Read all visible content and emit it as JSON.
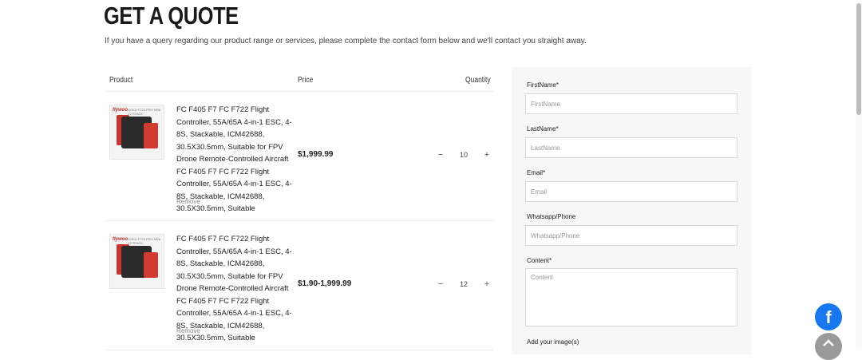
{
  "header": {
    "title": "GET A QUOTE",
    "subtitle": "If you have a query regarding our product range or services, please complete the contact form below and we'll contact you straight away."
  },
  "cart": {
    "columns": {
      "product": "Product",
      "price": "Price",
      "quantity": "Quantity"
    },
    "items": [
      {
        "description": "FC F405 F7 FC F722 Flight Controller, 55A/65A 4-in-1 ESC, 4-8S, Stackable, ICM42688, 30.5X30.5mm, Suitable for FPV Drone Remote-Controlled Aircraft FC F405 F7 FC F722 Flight Controller, 55A/65A 4-in-1 ESC, 4-8S, Stackable, ICM42688, 30.5X30.5mm, Suitable",
        "price": "$1,999.99",
        "quantity": "10",
        "remove_label": "Remove",
        "thumb_logo": "flywoo",
        "thumb_caption": "GOKU F722 PRO MINI V2 STACK"
      },
      {
        "description": "FC F405 F7 FC F722 Flight Controller, 55A/65A 4-in-1 ESC, 4-8S, Stackable, ICM42688, 30.5X30.5mm, Suitable for FPV Drone Remote-Controlled Aircraft FC F405 F7 FC F722 Flight Controller, 55A/65A 4-in-1 ESC, 4-8S, Stackable, ICM42688, 30.5X30.5mm, Suitable",
        "price": "$1.90-1,999.99",
        "quantity": "12",
        "remove_label": "Remove",
        "thumb_logo": "flywoo",
        "thumb_caption": "GOKU F722 PRO MINI V2 STACK"
      }
    ],
    "minus_symbol": "−",
    "plus_symbol": "+"
  },
  "form": {
    "firstname": {
      "label": "FirstName*",
      "placeholder": "FirstName"
    },
    "lastname": {
      "label": "LastName*",
      "placeholder": "LastName"
    },
    "email": {
      "label": "Email*",
      "placeholder": "Email"
    },
    "phone": {
      "label": "Whatsapp/Phone",
      "placeholder": "Whatsapp/Phone"
    },
    "content": {
      "label": "Content*",
      "placeholder": "Content"
    },
    "images_label": "Add your image(s)"
  },
  "floating": {
    "facebook_icon": "facebook-icon",
    "facebook_glyph": "f",
    "scroll_top_icon": "chevron-up-icon"
  },
  "colors": {
    "facebook": "#1877f2",
    "panel_bg": "#f7f7f7"
  }
}
